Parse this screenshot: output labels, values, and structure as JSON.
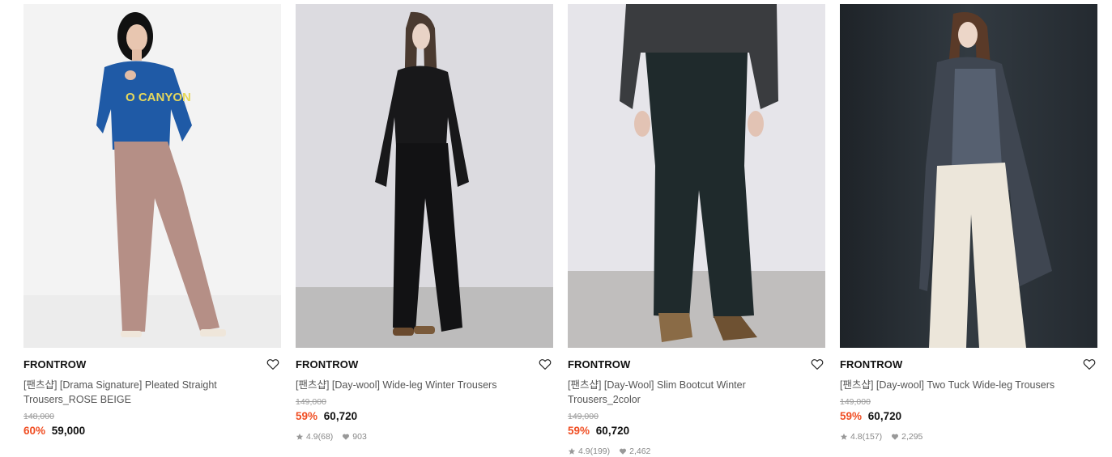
{
  "products": [
    {
      "brand": "FRONTROW",
      "name": "[팬츠샵] [Drama Signature] Pleated Straight Trousers_ROSE BEIGE",
      "original_price": "148,000",
      "discount": "60%",
      "price": "59,000",
      "rating": "",
      "reviews": "",
      "likes": "",
      "image": "model-sweater-rose-beige-trousers",
      "colors": {
        "bg": "#f2f2f2",
        "top": "#1f5aa6",
        "bottom": "#b58f86"
      }
    },
    {
      "brand": "FRONTROW",
      "name": "[팬츠샵] [Day-wool] Wide-leg Winter Trousers",
      "original_price": "149,000",
      "discount": "59%",
      "price": "60,720",
      "rating": "4.9",
      "reviews": "(68)",
      "likes": "903",
      "image": "model-black-wide-leg-trousers",
      "colors": {
        "bg": "#d9d8dc",
        "top": "#1a1a1c",
        "bottom": "#141416"
      }
    },
    {
      "brand": "FRONTROW",
      "name": "[팬츠샵] [Day-Wool] Slim Bootcut Winter Trousers_2color",
      "original_price": "149,000",
      "discount": "59%",
      "price": "60,720",
      "rating": "4.9",
      "reviews": "(199)",
      "likes": "2,462",
      "image": "model-bootcut-trousers-brown-boots",
      "colors": {
        "bg": "#e4e3e8",
        "top": "#3b3d3f",
        "bottom": "#1f2a2c"
      }
    },
    {
      "brand": "FRONTROW",
      "name": "[팬츠샵] [Day-wool] Two Tuck Wide-leg Trousers",
      "original_price": "149,000",
      "discount": "59%",
      "price": "60,720",
      "rating": "4.8",
      "reviews": "(157)",
      "likes": "2,295",
      "image": "model-coat-cream-wide-leg-trousers",
      "colors": {
        "bg": "#2a3036",
        "top": "#3e4550",
        "bottom": "#ece6da"
      }
    }
  ],
  "theme": {
    "discount_color": "#f04e23"
  }
}
